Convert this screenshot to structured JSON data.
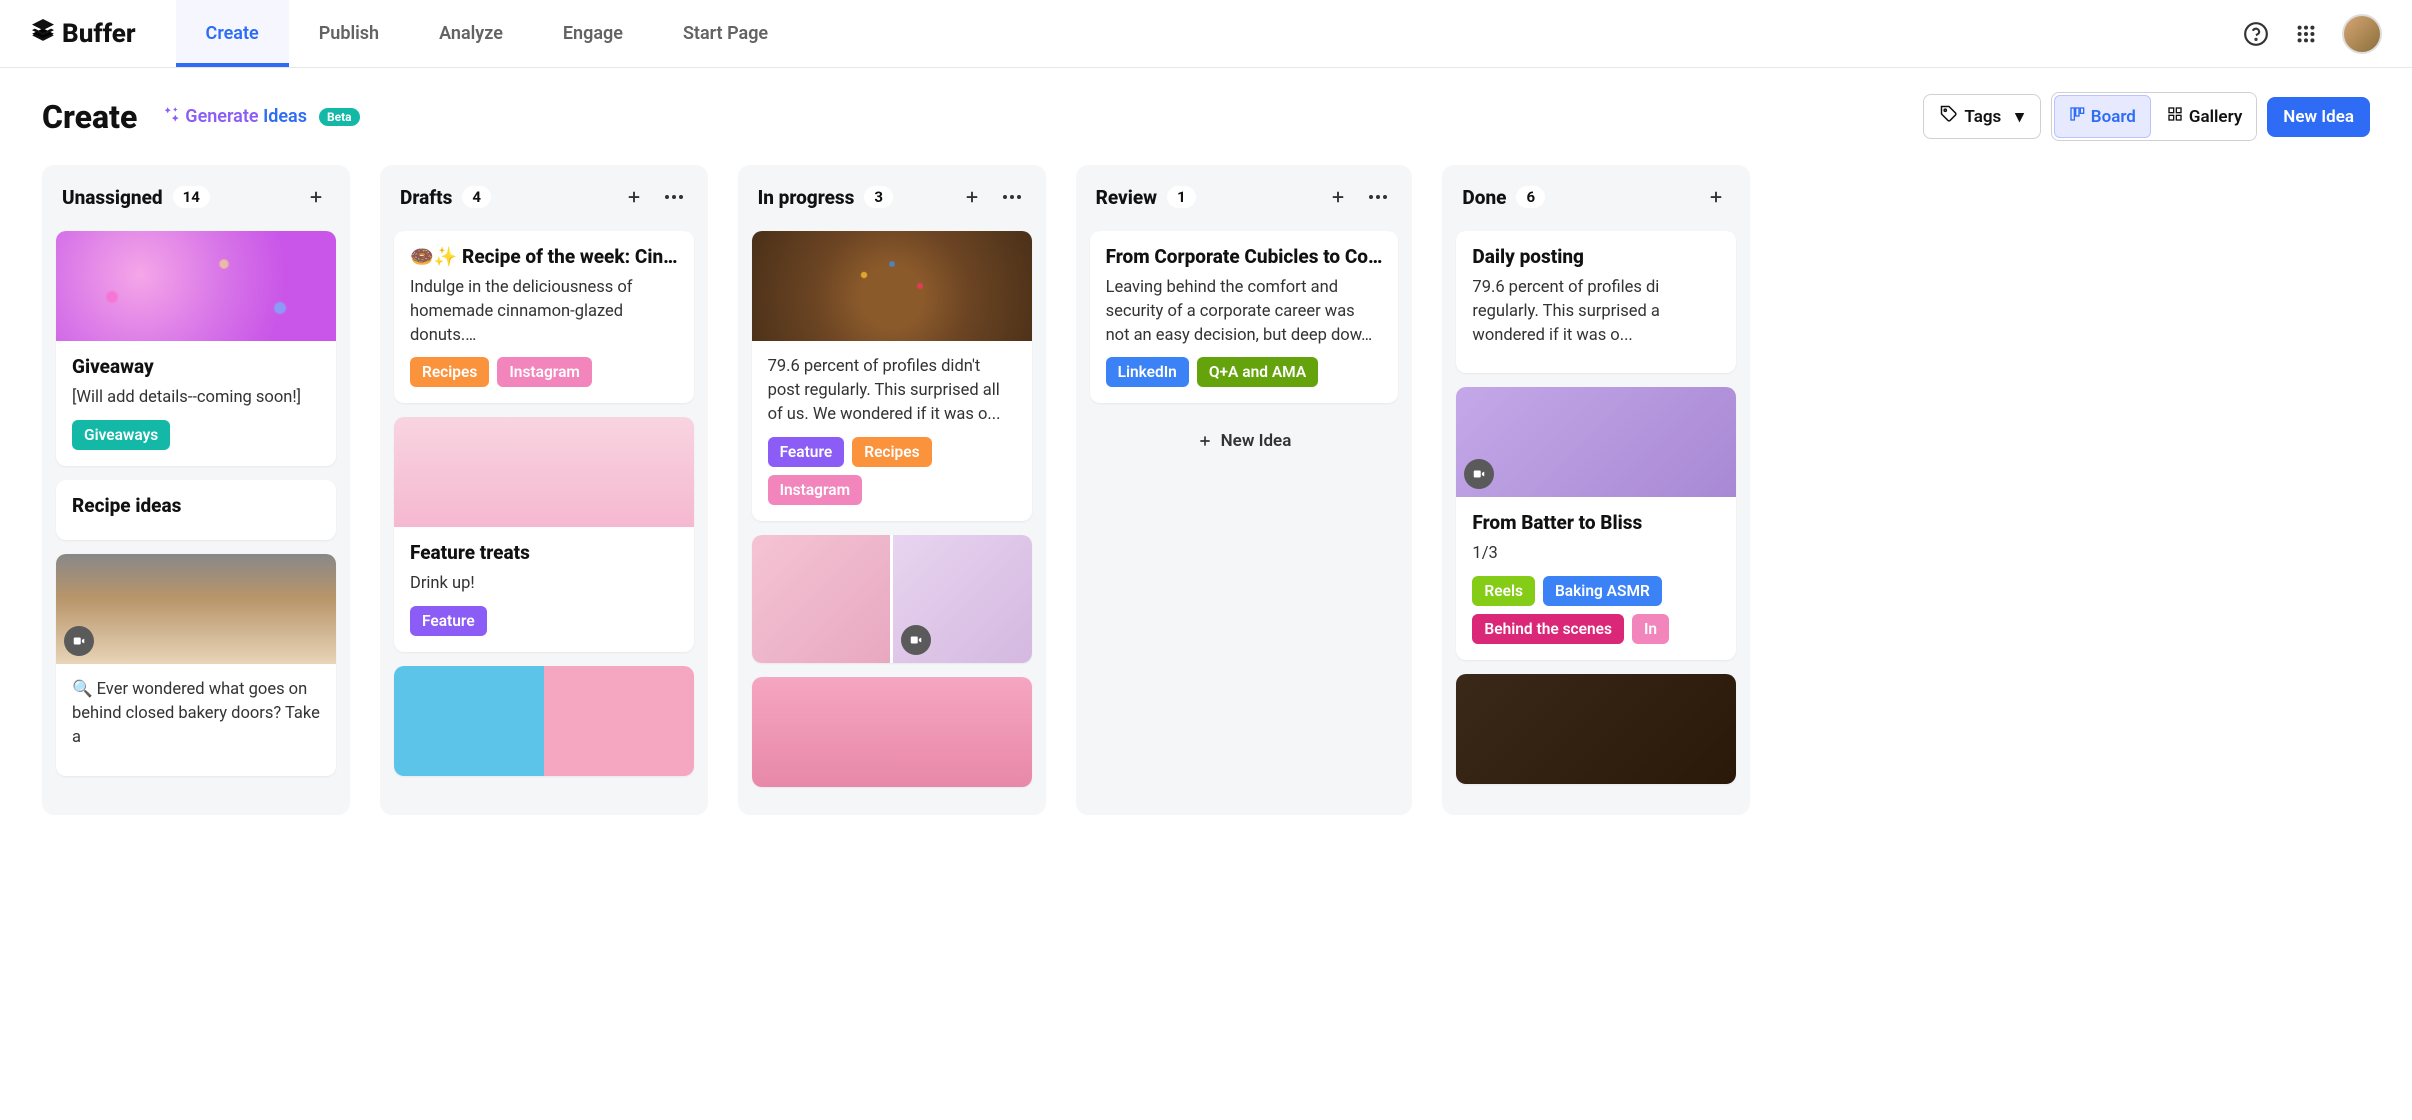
{
  "header": {
    "logo": "Buffer",
    "nav": [
      "Create",
      "Publish",
      "Analyze",
      "Engage",
      "Start Page"
    ],
    "active_nav": 0
  },
  "toolbar": {
    "title": "Create",
    "generate_label_1": "Generate",
    "generate_label_2": "Ideas",
    "beta": "Beta",
    "tags_label": "Tags",
    "board_label": "Board",
    "gallery_label": "Gallery",
    "new_idea_label": "New Idea"
  },
  "columns": [
    {
      "title": "Unassigned",
      "count": "14",
      "show_more": false,
      "cards": [
        {
          "image": "img-donut-purple",
          "title": "Giveaway",
          "text": "[Will add details--coming soon!]",
          "tags": [
            {
              "label": "Giveaways",
              "color": "#14b8a6"
            }
          ]
        },
        {
          "title": "Recipe ideas",
          "title_wrap": true
        },
        {
          "image": "img-baker",
          "video": true,
          "text": "🔍 Ever wondered what goes on behind closed bakery doors? Take a"
        }
      ]
    },
    {
      "title": "Drafts",
      "count": "4",
      "show_more": true,
      "cards": [
        {
          "title": "🍩✨ Recipe of the week: Cin…",
          "text": "Indulge in the deliciousness of homemade cinnamon-glazed donuts.…",
          "tags": [
            {
              "label": "Recipes",
              "color": "#fb923c"
            },
            {
              "label": "Instagram",
              "color": "#ec4899aa"
            }
          ]
        },
        {
          "image": "img-drinks",
          "title": "Feature treats",
          "text": "Drink up!",
          "title_wrap": true,
          "tags": [
            {
              "label": "Feature",
              "color": "#8b5cf6"
            }
          ]
        },
        {
          "image": "img-blue-pink"
        }
      ]
    },
    {
      "title": "In progress",
      "count": "3",
      "show_more": true,
      "cards": [
        {
          "image": "img-donut-choc",
          "text": "79.6 percent of profiles didn't post regularly. This surprised all of us. We wondered if it was o...",
          "tags": [
            {
              "label": "Feature",
              "color": "#8b5cf6"
            },
            {
              "label": "Recipes",
              "color": "#fb923c"
            },
            {
              "label": "Instagram",
              "color": "#ec4899aa"
            }
          ]
        },
        {
          "grid": true,
          "images": [
            "img-coffee",
            "img-cupcakes"
          ],
          "video": true
        },
        {
          "image": "img-pink-room"
        }
      ]
    },
    {
      "title": "Review",
      "count": "1",
      "show_more": true,
      "cards": [
        {
          "title": "From Corporate Cubicles to Co…",
          "text": "Leaving behind the comfort and security of a corporate career was not an easy decision, but deep dow…",
          "tags": [
            {
              "label": "LinkedIn",
              "color": "#3b82f6"
            },
            {
              "label": "Q+A and AMA",
              "color": "#65a30d"
            }
          ]
        }
      ],
      "new_idea": "New Idea"
    },
    {
      "title": "Done",
      "count": "6",
      "show_more": false,
      "cards": [
        {
          "title": "Daily posting",
          "title_wrap": true,
          "text": "79.6 percent of profiles di regularly. This surprised a wondered if it was o..."
        },
        {
          "image": "img-purple",
          "video": true,
          "title": "From Batter to Bliss",
          "title_wrap": true,
          "text": "1/3",
          "tags": [
            {
              "label": "Reels",
              "color": "#84cc16"
            },
            {
              "label": "Baking ASMR",
              "color": "#3b82f6"
            },
            {
              "label": "Behind the scenes",
              "color": "#db2777"
            },
            {
              "label": "In",
              "color": "#ec4899aa"
            }
          ]
        },
        {
          "image": "img-dark"
        }
      ]
    }
  ]
}
